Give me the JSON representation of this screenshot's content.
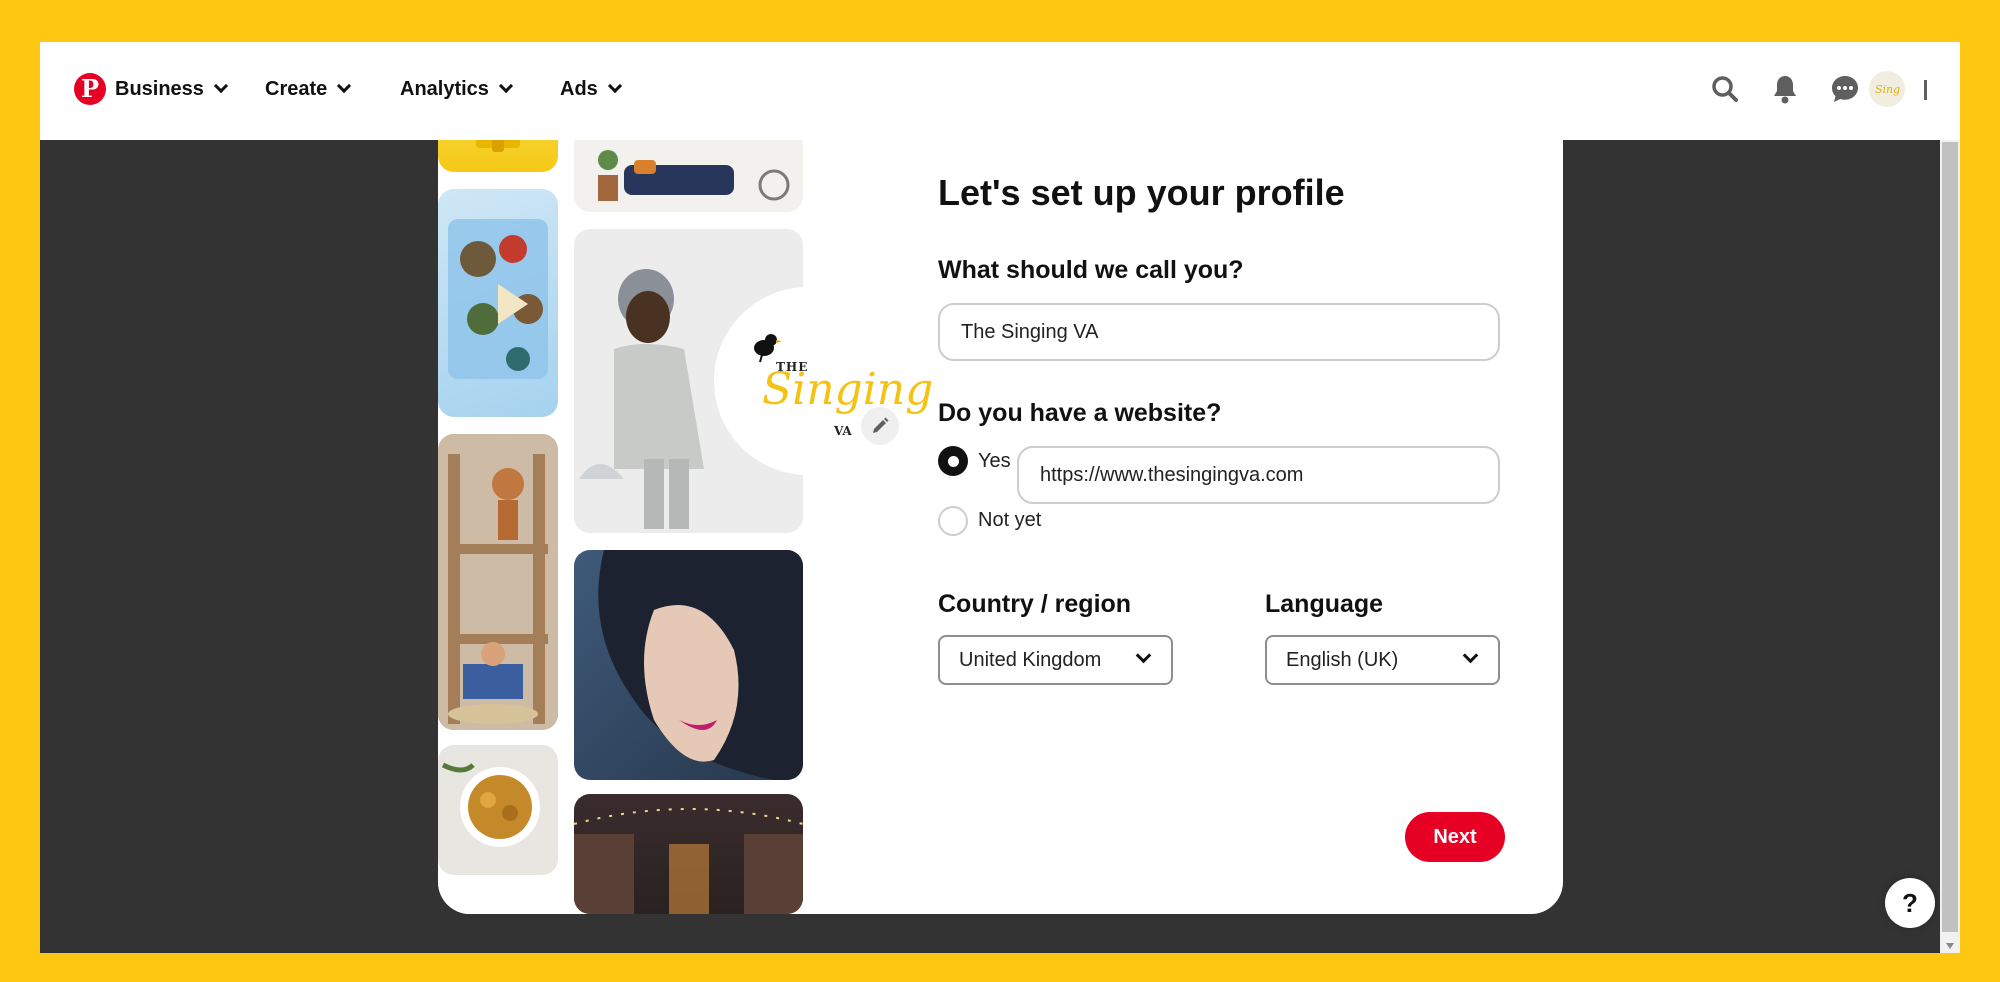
{
  "header": {
    "logo_letter": "P",
    "nav": [
      {
        "label": "Business"
      },
      {
        "label": "Create"
      },
      {
        "label": "Analytics"
      },
      {
        "label": "Ads"
      }
    ],
    "icons": [
      "search-icon",
      "bell-icon",
      "messages-icon"
    ]
  },
  "profile_logo": {
    "the": "THE",
    "singing": "Singing",
    "va": "VA"
  },
  "form": {
    "title": "Let's set up your profile",
    "name_label": "What should we call you?",
    "name_value": "The Singing VA",
    "website_label": "Do you have a website?",
    "yes_label": "Yes",
    "website_value": "https://www.thesingingva.com",
    "no_label": "Not yet",
    "country_label": "Country / region",
    "country_value": "United Kingdom",
    "language_label": "Language",
    "language_value": "English (UK)",
    "next_label": "Next"
  },
  "help": {
    "label": "?"
  },
  "colors": {
    "brand": "#e60023",
    "frame": "#fec812",
    "backdrop": "#333333"
  }
}
